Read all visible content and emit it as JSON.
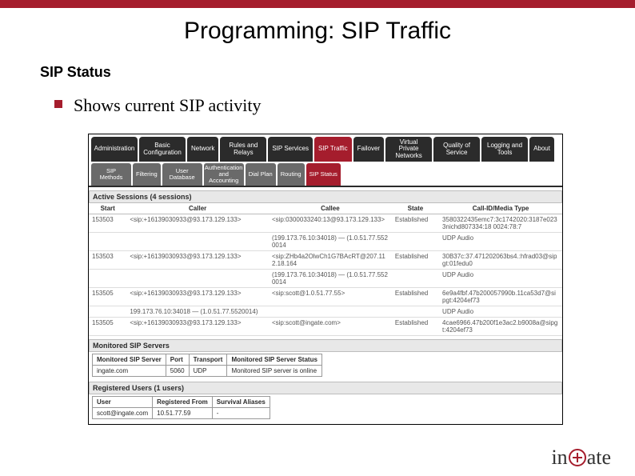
{
  "page": {
    "title": "Programming: SIP Traffic",
    "section": "SIP Status",
    "bullet": "Shows current SIP activity"
  },
  "tabs": {
    "items": [
      "Administration",
      "Basic Configuration",
      "Network",
      "Rules and Relays",
      "SIP Services",
      "SIP Traffic",
      "Failover",
      "Virtual Private Networks",
      "Quality of Service",
      "Logging and Tools",
      "About"
    ],
    "active_index": 5
  },
  "subtabs": {
    "items": [
      "SIP Methods",
      "Filtering",
      "User Database",
      "Authentication and Accounting",
      "Dial Plan",
      "Routing",
      "SIP Status"
    ],
    "active_index": 6
  },
  "active_sessions": {
    "title": "Active Sessions (4 sessions)",
    "columns": [
      "Start",
      "Caller",
      "Callee",
      "State",
      "Call-ID/Media Type"
    ],
    "rows": [
      {
        "start": "153503",
        "caller": "<sip:+16139030933@93.173.129.133>",
        "callee": "<sip:0300033240:13@93.173.129.133>",
        "state": "Established",
        "callid": "3580322435emc7:3c1742020:3187e0233nichd807334:18 0024:78:7"
      },
      {
        "start": "",
        "caller": "",
        "callee": "(199.173.76.10:34018) — (1.0.51.77.5520014",
        "state": "",
        "callid": "UDP Audio"
      },
      {
        "start": "153503",
        "caller": "<sip:+16139030933@93.173.129.133>",
        "callee": "<sip:ZHb4a2OlwCh1G7BAcRT@207.112.18.164",
        "state": "Established",
        "callid": "30B37c:37.471202063bs4.:hfrad03@sipgt:01fedu0"
      },
      {
        "start": "",
        "caller": "",
        "callee": "(199.173.76.10:34018) — (1.0.51.77.5520014",
        "state": "",
        "callid": "UDP Audio"
      },
      {
        "start": "153505",
        "caller": "<sip:+16139030933@93.173.129.133>",
        "callee": "<sip:scott@1.0.51.77.55>",
        "state": "Established",
        "callid": "6e9a4fbf.47b200057990b.11ca53d7@sipgt:4204ef73"
      },
      {
        "start": "",
        "caller": "199.173.76.10:34018 — (1.0.51.77.5520014)",
        "callee": "",
        "state": "",
        "callid": "UDP Audio"
      },
      {
        "start": "153505",
        "caller": "<sip:+16139030933@93.173.129.133>",
        "callee": "<sip:scott@ingate.com>",
        "state": "Established",
        "callid": "4cae6966.47b200f1e3ac2.b9008a@sipgt:4204ef73"
      }
    ]
  },
  "monitored": {
    "title": "Monitored SIP Servers",
    "columns": [
      "Monitored SIP Server",
      "Port",
      "Transport",
      "Monitored SIP Server Status"
    ],
    "rows": [
      {
        "server": "ingate.com",
        "port": "5060",
        "transport": "UDP",
        "status": "Monitored SIP server is online"
      }
    ]
  },
  "registered": {
    "title": "Registered Users (1 users)",
    "columns": [
      "User",
      "Registered From",
      "Survival Aliases"
    ],
    "rows": [
      {
        "user": "scott@ingate.com",
        "from": "10.51.77.59",
        "aliases": "-"
      }
    ]
  },
  "logo": {
    "prefix": "in",
    "suffix": "ate"
  }
}
